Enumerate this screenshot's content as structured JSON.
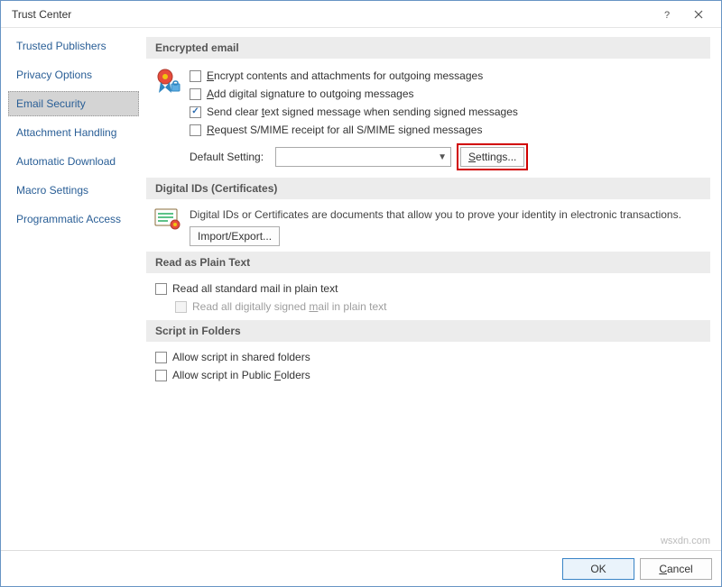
{
  "window": {
    "title": "Trust Center"
  },
  "sidebar": {
    "items": [
      {
        "label": "Trusted Publishers",
        "selected": false
      },
      {
        "label": "Privacy Options",
        "selected": false
      },
      {
        "label": "Email Security",
        "selected": true
      },
      {
        "label": "Attachment Handling",
        "selected": false
      },
      {
        "label": "Automatic Download",
        "selected": false
      },
      {
        "label": "Macro Settings",
        "selected": false
      },
      {
        "label": "Programmatic Access",
        "selected": false
      }
    ]
  },
  "sections": {
    "encrypted": {
      "title": "Encrypted email",
      "opt_encrypt_pre": "",
      "opt_encrypt_u": "E",
      "opt_encrypt_post": "ncrypt contents and attachments for outgoing messages",
      "opt_add_pre": "",
      "opt_add_u": "A",
      "opt_add_post": "dd digital signature to outgoing messages",
      "opt_clear_pre": "Send clear ",
      "opt_clear_u": "t",
      "opt_clear_post": "ext signed message when sending signed messages",
      "opt_req_pre": "",
      "opt_req_u": "R",
      "opt_req_post": "equest S/MIME receipt for all S/MIME signed messages",
      "default_label": "Default Setting:",
      "default_value": "",
      "settings_btn_pre": "",
      "settings_btn_u": "S",
      "settings_btn_post": "ettings..."
    },
    "digitalids": {
      "title": "Digital IDs (Certificates)",
      "desc": "Digital IDs or Certificates are documents that allow you to prove your identity in electronic transactions.",
      "import_btn": "Import/Export..."
    },
    "plaintext": {
      "title": "Read as Plain Text",
      "opt_std": "Read all standard mail in plain text",
      "opt_signed_pre": "Read all digitally signed ",
      "opt_signed_u": "m",
      "opt_signed_post": "ail in plain text"
    },
    "script": {
      "title": "Script in Folders",
      "opt_shared": "Allow script in shared folders",
      "opt_public_pre": "Allow script in Public ",
      "opt_public_u": "F",
      "opt_public_post": "olders"
    }
  },
  "footer": {
    "ok": "OK",
    "cancel_u": "C",
    "cancel_post": "ancel"
  },
  "watermark": "wsxdn.com"
}
